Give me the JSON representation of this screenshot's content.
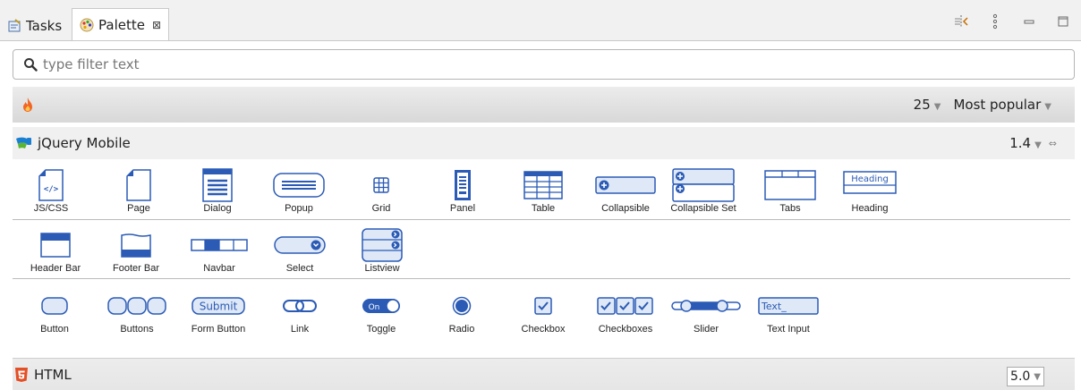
{
  "tabs": [
    {
      "label": "Tasks"
    },
    {
      "label": "Palette",
      "close": "⊠"
    }
  ],
  "filter": {
    "placeholder": "type filter text"
  },
  "popular": {
    "count": "25",
    "sort": "Most popular"
  },
  "jqm": {
    "title": "jQuery Mobile",
    "version": "1.4"
  },
  "rows": [
    [
      "JS/CSS",
      "Page",
      "Dialog",
      "Popup",
      "Grid",
      "Panel",
      "Table",
      "Collapsible",
      "Collapsible Set",
      "Tabs",
      "Heading"
    ],
    [
      "Header Bar",
      "Footer Bar",
      "Navbar",
      "Select",
      "Listview"
    ],
    [
      "Button",
      "Buttons",
      "Form Button",
      "Link",
      "Toggle",
      "Radio",
      "Checkbox",
      "Checkboxes",
      "Slider",
      "Text Input"
    ]
  ],
  "icon_text": {
    "submit": "Submit",
    "on": "On",
    "text": "Text_",
    "heading": "Heading",
    "js": "</>"
  },
  "html": {
    "title": "HTML",
    "version": "5.0"
  },
  "colors": {
    "accent": "#2b5bb5",
    "accent_light": "#dfe8f7",
    "flame": "#f26522",
    "html5": "#e34f26"
  }
}
